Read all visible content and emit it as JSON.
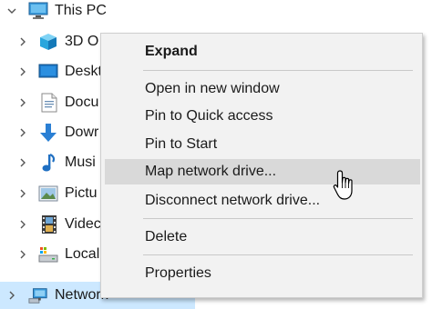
{
  "tree": {
    "items": [
      {
        "label": "This PC",
        "icon": "this-pc-icon",
        "expanded": true
      },
      {
        "label": "3D O",
        "icon": "3d-objects-icon",
        "expanded": false
      },
      {
        "label": "Deskt",
        "icon": "desktop-icon",
        "expanded": false
      },
      {
        "label": "Docu",
        "icon": "documents-icon",
        "expanded": false
      },
      {
        "label": "Dowr",
        "icon": "downloads-icon",
        "expanded": false
      },
      {
        "label": "Musi",
        "icon": "music-icon",
        "expanded": false
      },
      {
        "label": "Pictu",
        "icon": "pictures-icon",
        "expanded": false
      },
      {
        "label": "Videc",
        "icon": "videos-icon",
        "expanded": false
      },
      {
        "label": "Local",
        "icon": "local-disk-icon",
        "expanded": false
      },
      {
        "label": "Network",
        "icon": "network-icon",
        "expanded": false,
        "selected": true
      }
    ]
  },
  "context_menu": {
    "items": [
      {
        "label": "Expand",
        "bold": true
      },
      {
        "label": "Open in new window"
      },
      {
        "label": "Pin to Quick access"
      },
      {
        "label": "Pin to Start"
      },
      {
        "label": "Map network drive...",
        "hovered": true
      },
      {
        "label": "Disconnect network drive..."
      },
      {
        "label": "Delete"
      },
      {
        "label": "Properties"
      }
    ]
  },
  "colors": {
    "selection": "#cce8ff",
    "menu_background": "#f2f2f2",
    "menu_hover": "#d9d9d9"
  }
}
